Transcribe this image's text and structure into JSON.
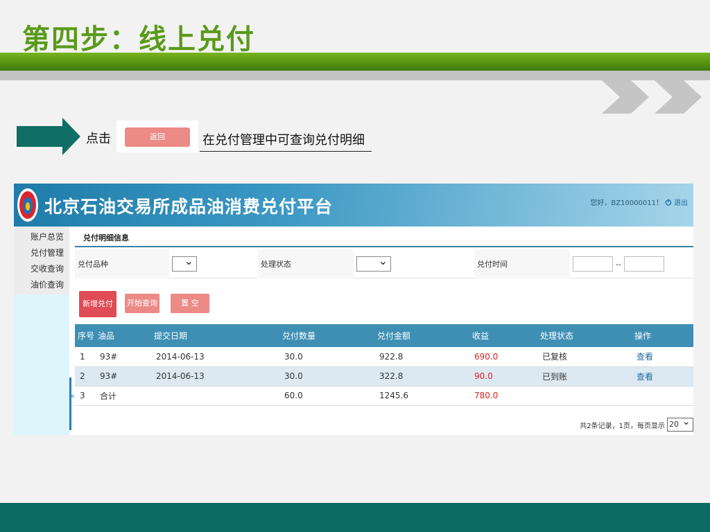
{
  "slide": {
    "title": "第四步：线上兑付",
    "click_label": "点击",
    "back_button": "返回",
    "note": "在兑付管理中可查询兑付明细"
  },
  "app": {
    "title": "北京石油交易所成品油消费兑付平台",
    "user_greeting": "您好，BZ10000011！",
    "logout": "退出"
  },
  "sidebar": {
    "items": [
      {
        "label": "账户总览"
      },
      {
        "label": "兑付管理"
      },
      {
        "label": "交收查询"
      },
      {
        "label": "油价查询"
      }
    ],
    "collapse_glyph": "«"
  },
  "panel": {
    "title": "兑付明细信息"
  },
  "filters": {
    "product_label": "兑付品种",
    "status_label": "处理状态",
    "time_label": "兑付时间",
    "date_sep": "--"
  },
  "buttons": {
    "new": "新增兑付",
    "query": "开始查询",
    "reset": "置 空"
  },
  "table": {
    "headers": [
      "序号",
      "油品",
      "提交日期",
      "兑付数量",
      "兑付金额",
      "收益",
      "处理状态",
      "操作"
    ],
    "rows": [
      [
        "1",
        "93#",
        "2014-06-13",
        "30.0",
        "922.8",
        "690.0",
        "已复核",
        "查看"
      ],
      [
        "2",
        "93#",
        "2014-06-13",
        "30.0",
        "322.8",
        "90.0",
        "已到账",
        "查看"
      ],
      [
        "3",
        "合计",
        "",
        "60.0",
        "1245.6",
        "780.0",
        "",
        ""
      ]
    ]
  },
  "pager": {
    "summary": "共2条记录，1页，每页显示",
    "page_size": "20"
  },
  "colors": {
    "title_green": "#5a9a1a",
    "header_blue": "#3f8fb4",
    "button_red": "#e04b55",
    "button_pink": "#ec8a86",
    "profit_red": "#e02020",
    "footer_teal": "#0c6b62"
  }
}
